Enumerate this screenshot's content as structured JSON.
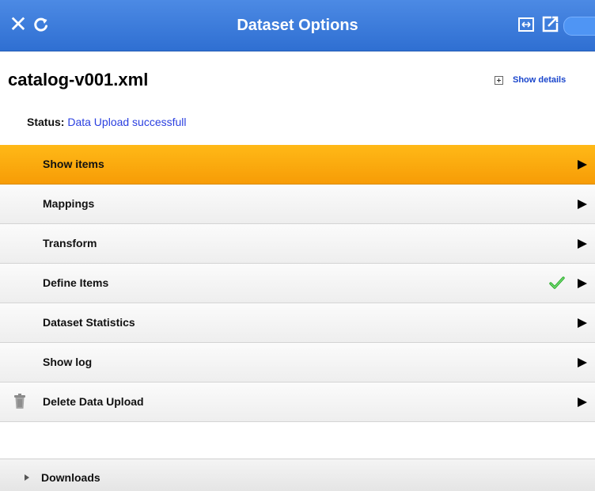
{
  "titlebar": {
    "title": "Dataset Options",
    "close_icon": "close-icon",
    "refresh_icon": "refresh-icon",
    "expand_icon": "expand-icon",
    "share_icon": "share-icon",
    "color": "#2f6fd2"
  },
  "dataset": {
    "name": "catalog-v001.xml",
    "details_link": "Show details"
  },
  "status": {
    "label": "Status:",
    "value": "Data Upload successfull"
  },
  "menu": {
    "active_color": "#f8a30b",
    "items": [
      {
        "label": "Show items",
        "active": true
      },
      {
        "label": "Mappings"
      },
      {
        "label": "Transform"
      },
      {
        "label": "Define Items",
        "icon": "checkmark-icon"
      },
      {
        "label": "Dataset Statistics"
      },
      {
        "label": "Show log"
      },
      {
        "label": "Delete Data Upload",
        "icon": "trash-icon"
      }
    ]
  },
  "downloads": {
    "label": "Downloads"
  }
}
